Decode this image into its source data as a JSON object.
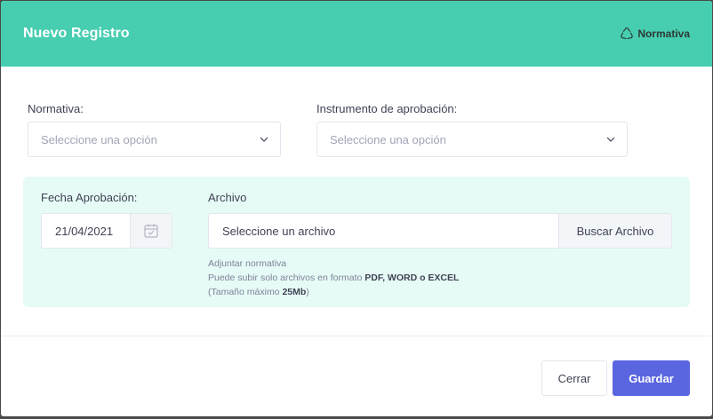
{
  "modal": {
    "title": "Nuevo Registro",
    "brand": "Normativa"
  },
  "form": {
    "normativa": {
      "label": "Normativa:",
      "placeholder": "Seleccione una opción"
    },
    "instrumento": {
      "label": "Instrumento de aprobación:",
      "placeholder": "Seleccione una opción"
    },
    "fecha": {
      "label": "Fecha Aprobación:",
      "value": "21/04/2021"
    },
    "archivo": {
      "label": "Archivo",
      "placeholder": "Seleccione un archivo",
      "button": "Buscar Archivo",
      "help_line1": "Adjuntar normativa",
      "help_line2_prefix": "Puede subir solo archivos en formato ",
      "help_line2_formats": "PDF, WORD o EXCEL",
      "help_line3_prefix": "(Tamaño máximo ",
      "help_line3_size": "25Mb",
      "help_line3_suffix": ")"
    }
  },
  "footer": {
    "close_label": "Cerrar",
    "save_label": "Guardar"
  },
  "colors": {
    "header": "#47cdb0",
    "panel": "#e6fbf6",
    "primary": "#5966e0"
  }
}
